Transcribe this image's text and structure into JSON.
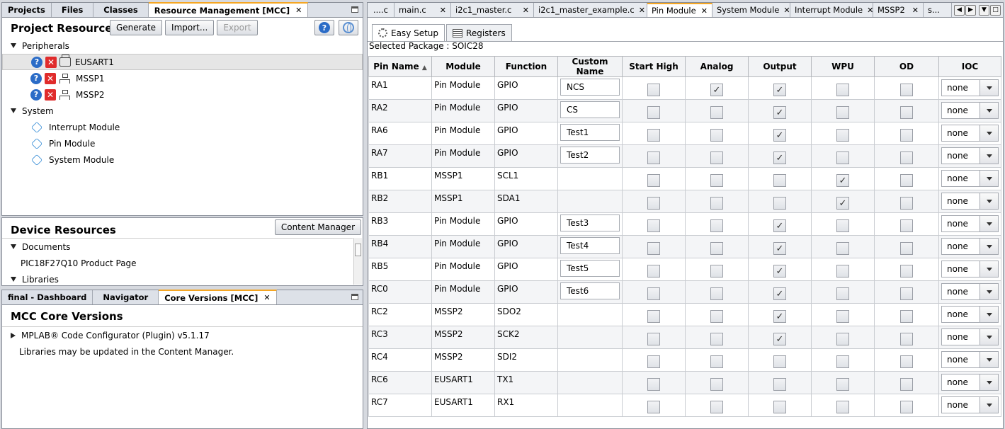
{
  "left_top_tabs": [
    "Projects",
    "Files",
    "Classes",
    "Resource Management [MCC]"
  ],
  "project_resources": {
    "title": "Project Resources",
    "buttons": {
      "generate": "Generate",
      "import": "Import...",
      "export": "Export"
    },
    "tree": {
      "peripherals_label": "Peripherals",
      "peripherals": [
        "EUSART1",
        "MSSP1",
        "MSSP2"
      ],
      "system_label": "System",
      "system": [
        "Interrupt Module",
        "Pin Module",
        "System Module"
      ]
    }
  },
  "device_resources": {
    "title": "Device Resources",
    "content_manager": "Content Manager",
    "documents_label": "Documents",
    "document": "PIC18F27Q10 Product Page",
    "libraries_label": "Libraries"
  },
  "bottom_tabs": [
    "final - Dashboard",
    "Navigator",
    "Core Versions [MCC]"
  ],
  "core_versions": {
    "title": "MCC Core Versions",
    "plugin": "MPLAB® Code Configurator (Plugin) v5.1.17",
    "note": "Libraries may be updated in the Content Manager."
  },
  "editor_tabs": [
    "....c",
    "main.c",
    "i2c1_master.c",
    "i2c1_master_example.c",
    "Pin Module",
    "System Module",
    "Interrupt Module",
    "MSSP2",
    "s..."
  ],
  "pin_module": {
    "subtabs": {
      "easy": "Easy Setup",
      "registers": "Registers"
    },
    "package": "Selected Package : SOIC28",
    "headers": [
      "Pin Name",
      "Module",
      "Function",
      "Custom Name",
      "Start High",
      "Analog",
      "Output",
      "WPU",
      "OD",
      "IOC"
    ],
    "rows": [
      {
        "pin": "RA1",
        "module": "Pin Module",
        "function": "GPIO",
        "custom": "NCS",
        "start_high": false,
        "analog": true,
        "output": true,
        "wpu": false,
        "od": false,
        "ioc": "none"
      },
      {
        "pin": "RA2",
        "module": "Pin Module",
        "function": "GPIO",
        "custom": "CS",
        "start_high": false,
        "analog": false,
        "output": true,
        "wpu": false,
        "od": false,
        "ioc": "none"
      },
      {
        "pin": "RA6",
        "module": "Pin Module",
        "function": "GPIO",
        "custom": "Test1",
        "start_high": false,
        "analog": false,
        "output": true,
        "wpu": false,
        "od": false,
        "ioc": "none"
      },
      {
        "pin": "RA7",
        "module": "Pin Module",
        "function": "GPIO",
        "custom": "Test2",
        "start_high": false,
        "analog": false,
        "output": true,
        "wpu": false,
        "od": false,
        "ioc": "none"
      },
      {
        "pin": "RB1",
        "module": "MSSP1",
        "function": "SCL1",
        "custom": null,
        "start_high": false,
        "analog": false,
        "output": false,
        "wpu": true,
        "od": false,
        "ioc": "none"
      },
      {
        "pin": "RB2",
        "module": "MSSP1",
        "function": "SDA1",
        "custom": null,
        "start_high": false,
        "analog": false,
        "output": false,
        "wpu": true,
        "od": false,
        "ioc": "none"
      },
      {
        "pin": "RB3",
        "module": "Pin Module",
        "function": "GPIO",
        "custom": "Test3",
        "start_high": false,
        "analog": false,
        "output": true,
        "wpu": false,
        "od": false,
        "ioc": "none"
      },
      {
        "pin": "RB4",
        "module": "Pin Module",
        "function": "GPIO",
        "custom": "Test4",
        "start_high": false,
        "analog": false,
        "output": true,
        "wpu": false,
        "od": false,
        "ioc": "none"
      },
      {
        "pin": "RB5",
        "module": "Pin Module",
        "function": "GPIO",
        "custom": "Test5",
        "start_high": false,
        "analog": false,
        "output": true,
        "wpu": false,
        "od": false,
        "ioc": "none"
      },
      {
        "pin": "RC0",
        "module": "Pin Module",
        "function": "GPIO",
        "custom": "Test6",
        "start_high": false,
        "analog": false,
        "output": true,
        "wpu": false,
        "od": false,
        "ioc": "none"
      },
      {
        "pin": "RC2",
        "module": "MSSP2",
        "function": "SDO2",
        "custom": null,
        "start_high": false,
        "analog": false,
        "output": true,
        "wpu": false,
        "od": false,
        "ioc": "none"
      },
      {
        "pin": "RC3",
        "module": "MSSP2",
        "function": "SCK2",
        "custom": null,
        "start_high": false,
        "analog": false,
        "output": true,
        "wpu": false,
        "od": false,
        "ioc": "none"
      },
      {
        "pin": "RC4",
        "module": "MSSP2",
        "function": "SDI2",
        "custom": null,
        "start_high": false,
        "analog": false,
        "output": false,
        "wpu": false,
        "od": false,
        "ioc": "none"
      },
      {
        "pin": "RC6",
        "module": "EUSART1",
        "function": "TX1",
        "custom": null,
        "start_high": false,
        "analog": false,
        "output": false,
        "wpu": false,
        "od": false,
        "ioc": "none"
      },
      {
        "pin": "RC7",
        "module": "EUSART1",
        "function": "RX1",
        "custom": null,
        "start_high": false,
        "analog": false,
        "output": false,
        "wpu": false,
        "od": false,
        "ioc": "none"
      }
    ]
  }
}
